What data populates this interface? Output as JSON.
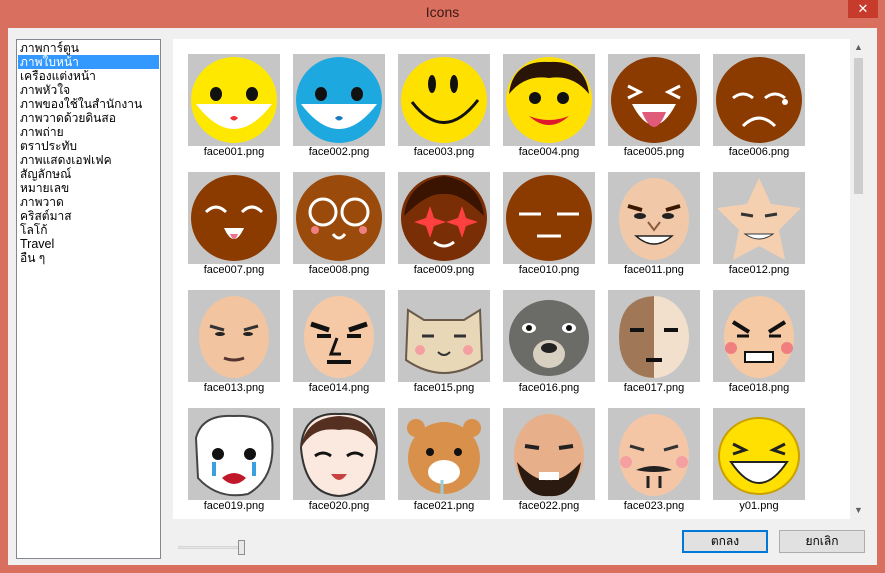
{
  "window": {
    "title": "Icons",
    "close_glyph": "✕"
  },
  "categories": [
    {
      "label": "ภาพการ์ตูน",
      "selected": false
    },
    {
      "label": "ภาพใบหน้า",
      "selected": true
    },
    {
      "label": "เครื่องแต่งหน้า",
      "selected": false
    },
    {
      "label": "ภาพหัวใจ",
      "selected": false
    },
    {
      "label": "ภาพของใช้ในสำนักงาน",
      "selected": false
    },
    {
      "label": "ภาพวาดด้วยดินสอ",
      "selected": false
    },
    {
      "label": "ภาพถ่าย",
      "selected": false
    },
    {
      "label": "ตราประทับ",
      "selected": false
    },
    {
      "label": "ภาพแสดงเอฟเฟค",
      "selected": false
    },
    {
      "label": "สัญลักษณ์",
      "selected": false
    },
    {
      "label": "หมายเลข",
      "selected": false
    },
    {
      "label": "ภาพวาด",
      "selected": false
    },
    {
      "label": "คริสต์มาส",
      "selected": false
    },
    {
      "label": "โลโก้",
      "selected": false
    },
    {
      "label": "Travel",
      "selected": false
    },
    {
      "label": "อื่น ๆ",
      "selected": false
    }
  ],
  "icons": [
    {
      "file": "face001.png",
      "style": "yellow-smile",
      "color": "#ffe800"
    },
    {
      "file": "face002.png",
      "style": "blue-smile",
      "color": "#1ea8e0"
    },
    {
      "file": "face003.png",
      "style": "classic-smiley",
      "color": "#ffe100"
    },
    {
      "file": "face004.png",
      "style": "curly-hair-face",
      "color": "#ffe000"
    },
    {
      "file": "face005.png",
      "style": "tongue-out",
      "color": "#8b3a00"
    },
    {
      "file": "face006.png",
      "style": "sad-face",
      "color": "#8b3a00"
    },
    {
      "file": "face007.png",
      "style": "happy-squint",
      "color": "#8b3a00"
    },
    {
      "file": "face008.png",
      "style": "glasses-face",
      "color": "#9a4a0a"
    },
    {
      "file": "face009.png",
      "style": "sparkle-eyes",
      "color": "#7a2e05"
    },
    {
      "file": "face010.png",
      "style": "meh-face",
      "color": "#8b3a00"
    },
    {
      "file": "face011.png",
      "style": "man-grin",
      "color": "#f2c9a8"
    },
    {
      "file": "face012.png",
      "style": "star-face",
      "color": "#f5d0b0"
    },
    {
      "file": "face013.png",
      "style": "bald-face",
      "color": "#f2c4a0"
    },
    {
      "file": "face014.png",
      "style": "stern-face",
      "color": "#f6c9a6"
    },
    {
      "file": "face015.png",
      "style": "cat-face",
      "color": "#e8d8b8"
    },
    {
      "file": "face016.png",
      "style": "wombat-face",
      "color": "#6b6b68"
    },
    {
      "file": "face017.png",
      "style": "half-face",
      "color": "#f2e0cc"
    },
    {
      "file": "face018.png",
      "style": "angry-face",
      "color": "#f4c9a4"
    },
    {
      "file": "face019.png",
      "style": "crying-face",
      "color": "#ffffff"
    },
    {
      "file": "face020.png",
      "style": "girl-face",
      "color": "#fbe9df"
    },
    {
      "file": "face021.png",
      "style": "hamster-face",
      "color": "#d8904a"
    },
    {
      "file": "face022.png",
      "style": "beard-man",
      "color": "#e8b08a"
    },
    {
      "file": "face023.png",
      "style": "mustache-bald",
      "color": "#f5c6a6"
    },
    {
      "file": "y01.png",
      "style": "yellow-laugh",
      "color": "#ffe000"
    }
  ],
  "buttons": {
    "ok": "ตกลง",
    "cancel": "ยกเลิก"
  },
  "scroll": {
    "up": "▲",
    "down": "▼"
  }
}
